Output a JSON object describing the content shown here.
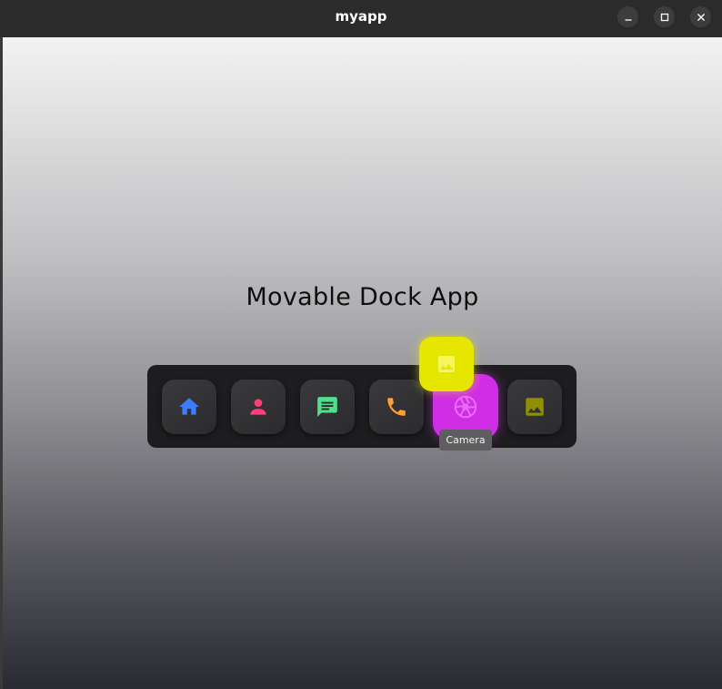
{
  "window": {
    "title": "myapp"
  },
  "app": {
    "heading": "Movable Dock App"
  },
  "dock": {
    "items": [
      {
        "name": "home",
        "icon": "home-icon",
        "color": "#3d7bff"
      },
      {
        "name": "contacts",
        "icon": "person-icon",
        "color": "#ff3d77"
      },
      {
        "name": "messages",
        "icon": "chat-icon",
        "color": "#4fe08a"
      },
      {
        "name": "phone",
        "icon": "phone-icon",
        "color": "#ff9f33"
      },
      {
        "name": "camera",
        "icon": "camera-aperture-icon",
        "color": "#cf2ee6",
        "highlighted": true
      },
      {
        "name": "gallery",
        "icon": "image-icon",
        "color": "#8f8f00"
      }
    ],
    "dragging_item": {
      "icon": "image-icon",
      "color": "#e6e600"
    },
    "tooltip": "Camera"
  }
}
